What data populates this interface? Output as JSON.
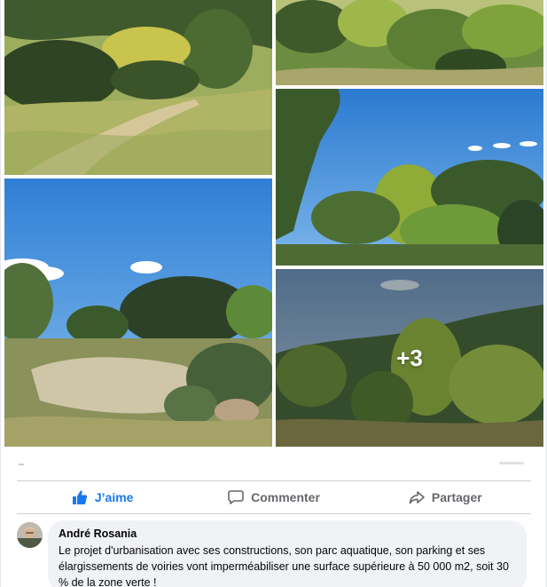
{
  "photos": {
    "more_count": "+3"
  },
  "actions": {
    "like_label": "J’aime",
    "comment_label": "Commenter",
    "share_label": "Partager"
  },
  "comment": {
    "author": "André Rosania",
    "text": "Le projet d'urbanisation avec ses constructions, son parc aquatique, son parking et ses élargissements de voiries vont imperméabiliser une surface supérieure à 50 000 m2, soit 30 % de la zone verte !"
  },
  "colors": {
    "like_active": "#1877f2",
    "action_text": "#65676b",
    "bubble_bg": "#f0f2f5",
    "divider": "#ced0d4"
  },
  "icons": {
    "like": "thumbs-up-icon",
    "comment": "speech-bubble-icon",
    "share": "share-arrow-icon"
  }
}
